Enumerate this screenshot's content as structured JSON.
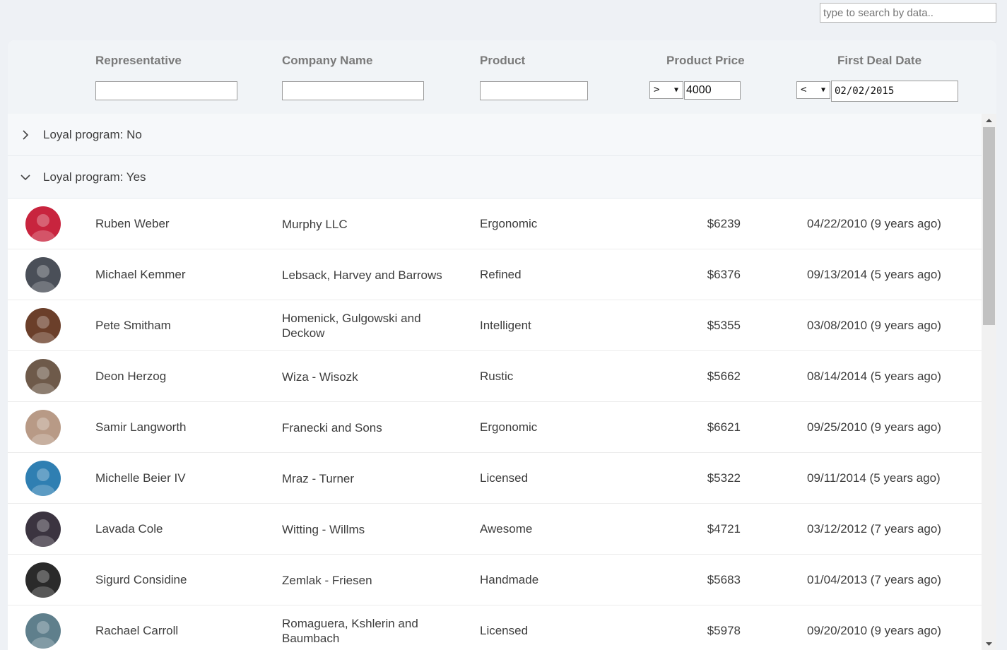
{
  "search": {
    "placeholder": "type to search by data.."
  },
  "columns": {
    "representative": "Representative",
    "company": "Company Name",
    "product": "Product",
    "price": "Product Price",
    "date": "First Deal Date"
  },
  "filters": {
    "price_operator": ">",
    "price_value": "4000",
    "date_operator": "<",
    "date_value": "02/02/2015"
  },
  "groups": [
    {
      "label": "Loyal program: No",
      "expanded": false
    },
    {
      "label": "Loyal program: Yes",
      "expanded": true
    }
  ],
  "rows": [
    {
      "rep": "Ruben Weber",
      "company": "Murphy LLC",
      "product": "Ergonomic",
      "price": "$6239",
      "date": "04/22/2010 (9 years ago)",
      "avatar_color": "#c8243e"
    },
    {
      "rep": "Michael Kemmer",
      "company": "Lebsack, Harvey and Barrows",
      "product": "Refined",
      "price": "$6376",
      "date": "09/13/2014 (5 years ago)",
      "avatar_color": "#4a4f58"
    },
    {
      "rep": "Pete Smitham",
      "company": "Homenick, Gulgowski and Deckow",
      "product": "Intelligent",
      "price": "$5355",
      "date": "03/08/2010 (9 years ago)",
      "avatar_color": "#6b3f2a"
    },
    {
      "rep": "Deon Herzog",
      "company": "Wiza - Wisozk",
      "product": "Rustic",
      "price": "$5662",
      "date": "08/14/2014 (5 years ago)",
      "avatar_color": "#6e5a4a"
    },
    {
      "rep": "Samir Langworth",
      "company": "Franecki and Sons",
      "product": "Ergonomic",
      "price": "$6621",
      "date": "09/25/2010 (9 years ago)",
      "avatar_color": "#b89a86"
    },
    {
      "rep": "Michelle Beier IV",
      "company": "Mraz - Turner",
      "product": "Licensed",
      "price": "$5322",
      "date": "09/11/2014 (5 years ago)",
      "avatar_color": "#2f7fb2"
    },
    {
      "rep": "Lavada Cole",
      "company": "Witting - Willms",
      "product": "Awesome",
      "price": "$4721",
      "date": "03/12/2012 (7 years ago)",
      "avatar_color": "#3b3440"
    },
    {
      "rep": "Sigurd Considine",
      "company": "Zemlak - Friesen",
      "product": "Handmade",
      "price": "$5683",
      "date": "01/04/2013 (7 years ago)",
      "avatar_color": "#2a2a2a"
    },
    {
      "rep": "Rachael Carroll",
      "company": "Romaguera, Kshlerin and Baumbach",
      "product": "Licensed",
      "price": "$5978",
      "date": "09/20/2010 (9 years ago)",
      "avatar_color": "#5f7f8c"
    }
  ]
}
